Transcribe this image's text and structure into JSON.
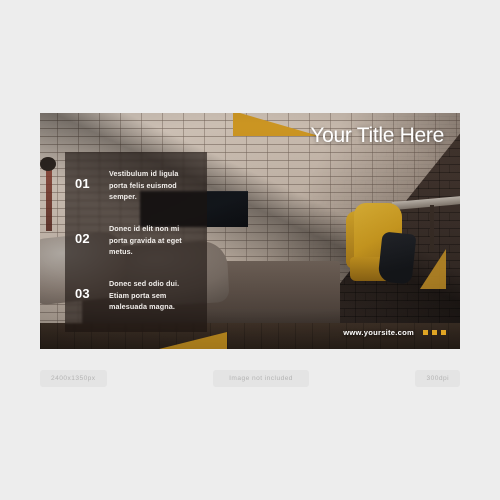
{
  "page": {
    "background_color": "#ededed"
  },
  "banner": {
    "headline": "Your Title Here",
    "accent_color": "#e0a524",
    "panel_color": "rgba(28,20,16,0.62)",
    "features": [
      {
        "number": "01",
        "text": "Vestibulum id ligula porta felis euismod semper."
      },
      {
        "number": "02",
        "text": "Donec id elit non mi porta gravida at eget metus."
      },
      {
        "number": "03",
        "text": "Donec sed odio dui. Etiam porta sem malesuada magna."
      }
    ],
    "footer": {
      "url": "www.yoursite.com",
      "dots": [
        "dot-1",
        "dot-2",
        "dot-3"
      ]
    },
    "scene": {
      "description": "interior living room with brick wall, grey sofa, yellow armchair",
      "icons": [
        "brick-wall",
        "grey-sofa",
        "yellow-armchair",
        "tv-panel",
        "side-table"
      ]
    }
  },
  "captions": {
    "left": "2400x1350px",
    "center": "Image not included",
    "right": "300dpi"
  }
}
